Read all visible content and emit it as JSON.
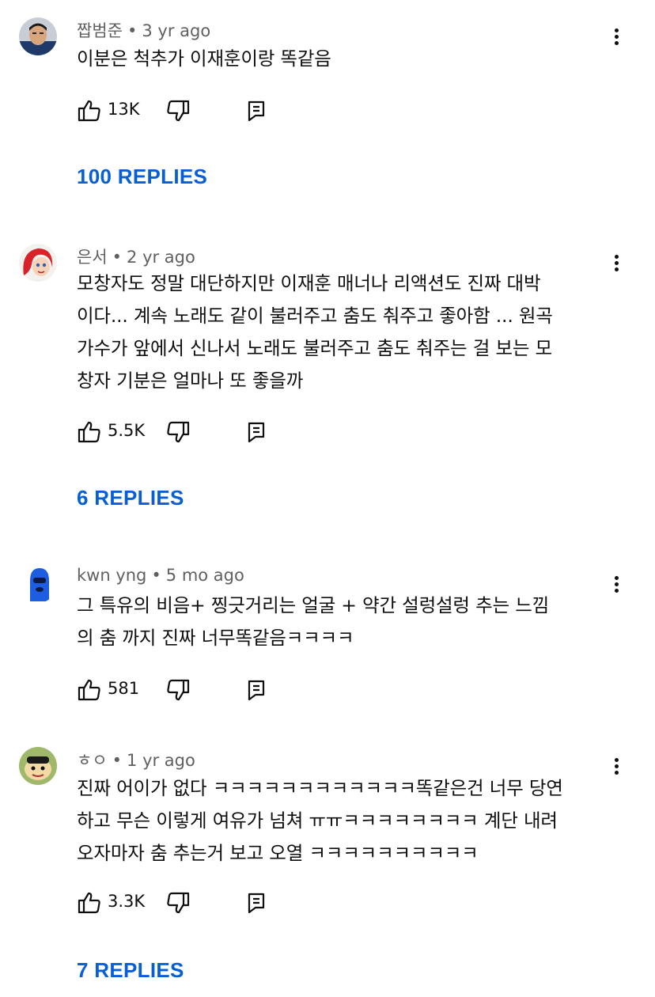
{
  "comments": [
    {
      "author": "짭범준",
      "time": "3 yr ago",
      "text": "이분은 척추가 이재훈이랑 똑같음",
      "likes": "13K",
      "replies": "100 REPLIES",
      "avatar_icon": "person-photo-avatar"
    },
    {
      "author": "은서",
      "time": "2 yr ago",
      "text": "모창자도 정말 대단하지만 이재훈 매너나 리액션도 진짜 대박\n이다... 계속 노래도 같이 불러주고 춤도 춰주고 좋아함 ... 원곡\n가수가 앞에서 신나서 노래도 불러주고 춤도 춰주는 걸 보는 모\n창자 기분은 얼마나 또 좋을까",
      "likes": "5.5K",
      "replies": "6 REPLIES",
      "avatar_icon": "red-hair-cartoon-avatar"
    },
    {
      "author": "kwn yng",
      "time": "5 mo ago",
      "text": "그 특유의 비음+ 찡긋거리는 얼굴 + 약간 설렁설렁 추는 느낌\n의 춤 까지 진짜 너무똑같음ㅋㅋㅋㅋ",
      "likes": "581",
      "replies": "",
      "avatar_icon": "blue-balaclava-avatar"
    },
    {
      "author": "ㅎㅇ",
      "time": "1 yr ago",
      "text": "진짜 어이가 없다 ㅋㅋㅋㅋㅋㅋㅋㅋㅋㅋㅋㅋ똑같은건 너무 당연\n하고 무슨 이렇게 여유가 넘쳐 ㅠㅠㅋㅋㅋㅋㅋㅋㅋㅋ 계단 내려\n오자마자 춤 추는거 보고 오열 ㅋㅋㅋㅋㅋㅋㅋㅋㅋㅋ",
      "likes": "3.3K",
      "replies": "7 REPLIES",
      "avatar_icon": "cartoon-character-avatar"
    }
  ],
  "separator": "•",
  "colors": {
    "link": "#065fd4",
    "meta": "#606060",
    "text": "#0f0f0f"
  }
}
